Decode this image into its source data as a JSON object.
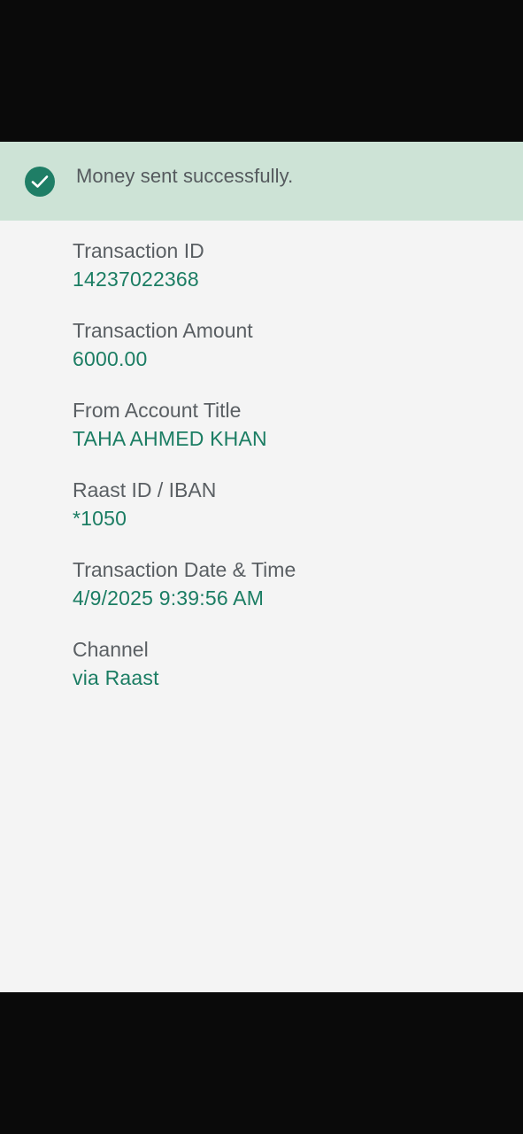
{
  "banner": {
    "message": "Money sent successfully.",
    "icon": "check-circle-icon",
    "accent_color": "#1f7e66",
    "background_color": "#cde3d6"
  },
  "details": [
    {
      "label": "Transaction ID",
      "value": "14237022368"
    },
    {
      "label": "Transaction Amount",
      "value": "6000.00"
    },
    {
      "label": "From Account Title",
      "value": "TAHA AHMED KHAN"
    },
    {
      "label": "Raast ID / IBAN",
      "value": "*1050"
    },
    {
      "label": "Transaction Date & Time",
      "value": "4/9/2025 9:39:56 AM"
    },
    {
      "label": "Channel",
      "value": "via Raast"
    }
  ],
  "colors": {
    "value_text": "#1b7d63",
    "label_text": "#5a5f63",
    "page_background": "#f4f4f4"
  }
}
